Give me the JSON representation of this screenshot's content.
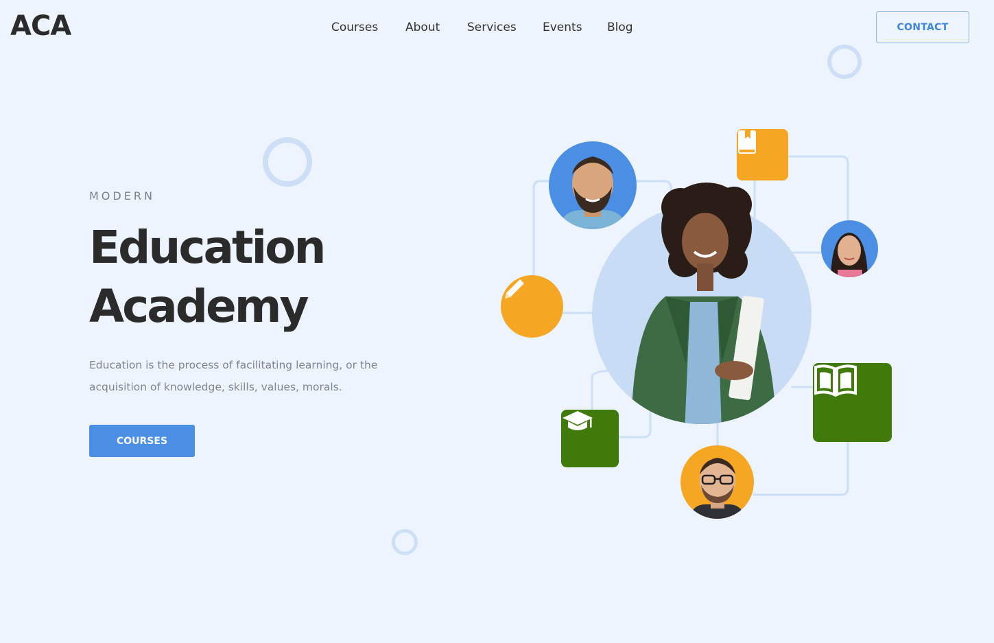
{
  "brand": {
    "logo_text": "ACA"
  },
  "nav": {
    "items": [
      {
        "label": "Courses"
      },
      {
        "label": "About"
      },
      {
        "label": "Services"
      },
      {
        "label": "Events"
      },
      {
        "label": "Blog"
      }
    ],
    "contact_label": "CONTACT"
  },
  "hero": {
    "eyebrow": "MODERN",
    "title_line1": "Education",
    "title_line2": "Academy",
    "description": "Education is the process of facilitating learning, or the acquisition of knowledge, skills, values, morals.",
    "cta_label": "COURSES"
  },
  "icons": {
    "top_book": "book-bookmark-icon",
    "pencil": "pencil-icon",
    "graduation": "graduation-cap-icon",
    "open_book": "open-book-icon"
  },
  "colors": {
    "background": "#edf4fe",
    "accent_blue": "#4a8fe3",
    "accent_orange": "#f5a623",
    "accent_green": "#3f7a0b",
    "light_blue_circle": "#c9dcf5",
    "text_dark": "#2b2b2b",
    "text_muted": "#80858c"
  }
}
